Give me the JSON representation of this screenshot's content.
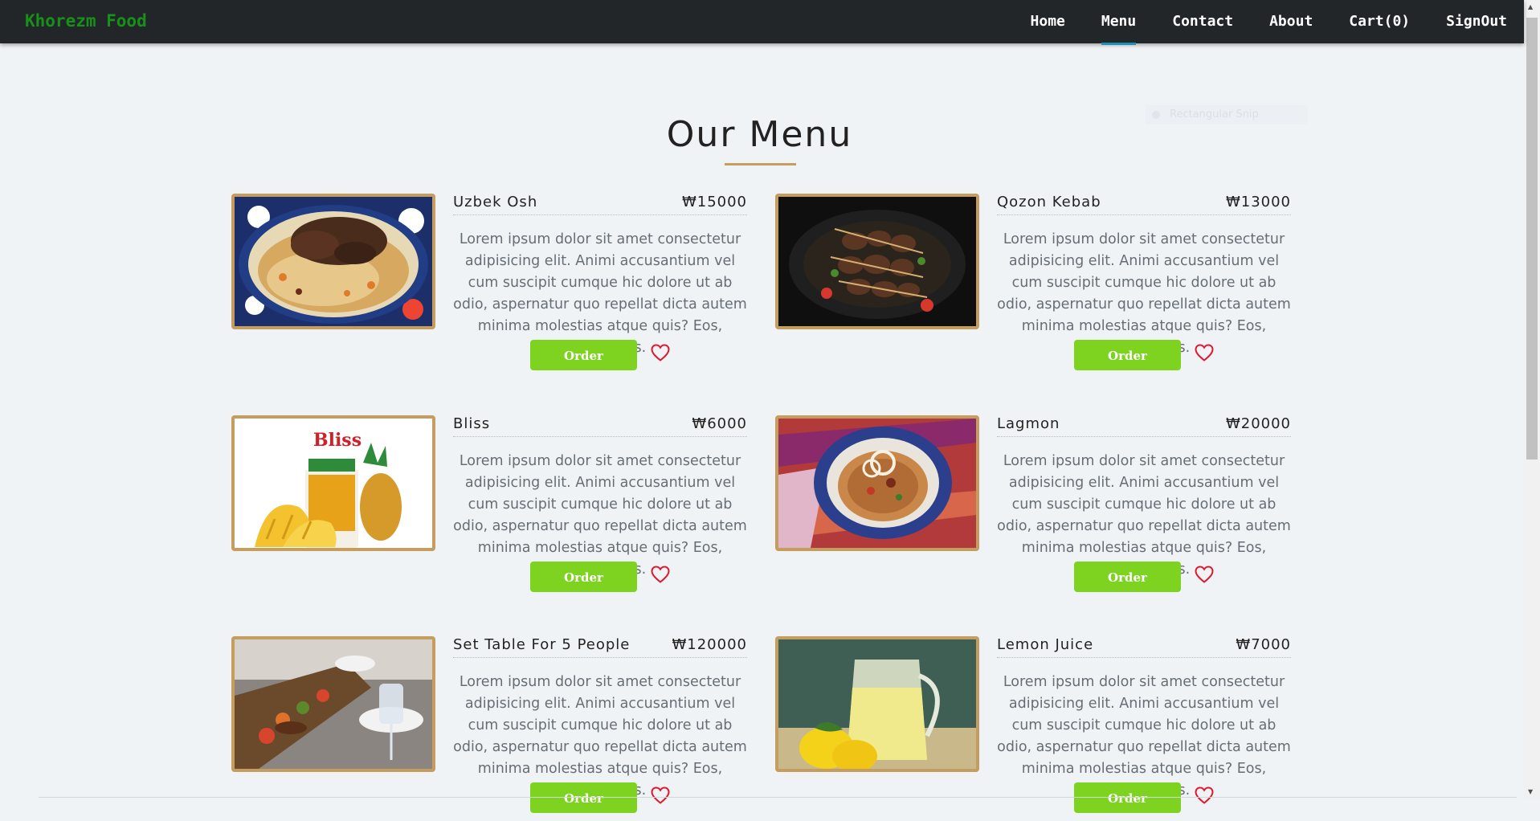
{
  "navbar": {
    "brand": "Khorezm Food",
    "links": [
      "Home",
      "Menu",
      "Contact",
      "About",
      "Cart(0)",
      "SignOut"
    ],
    "active": "Menu"
  },
  "ghost_widget": "Rectangular Snip",
  "page": {
    "title": "Our Menu"
  },
  "order_label": "Order",
  "description": "Lorem ipsum dolor sit amet consectetur adipisicing elit. Animi accusantium vel cum suscipit cumque hic dolore ut ab odio, aspernatur quo repellat dicta autem minima molestias atque quis? Eos, voluptatibus.",
  "items": [
    {
      "name": "Uzbek Osh",
      "price": "₩15000",
      "image": "osh-plov-photo"
    },
    {
      "name": "Qozon Kebab",
      "price": "₩13000",
      "image": "kebab-skewers-photo"
    },
    {
      "name": "Bliss",
      "price": "₩6000",
      "image": "bliss-pineapple-juice-photo"
    },
    {
      "name": "Lagmon",
      "price": "₩20000",
      "image": "lagmon-noodles-photo"
    },
    {
      "name": "Set Table For 5 People",
      "price": "₩120000",
      "image": "set-table-photo"
    },
    {
      "name": "Lemon Juice",
      "price": "₩7000",
      "image": "lemon-juice-photo"
    }
  ],
  "colors": {
    "navbar_bg": "#222629",
    "brand": "#179119",
    "active_underline": "#1b8fb5",
    "accent_gold": "#c59d5f",
    "order_button": "#7ed321",
    "heart": "#e0182d",
    "page_bg": "#f0f3f6"
  }
}
